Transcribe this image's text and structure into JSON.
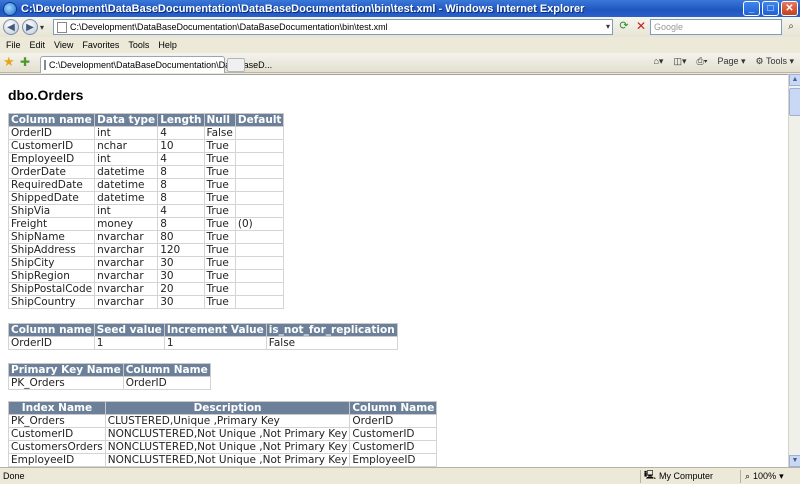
{
  "window": {
    "title": "C:\\Development\\DataBaseDocumentation\\DataBaseDocumentation\\bin\\test.xml - Windows Internet Explorer",
    "buttons": {
      "minimize": "_",
      "maximize": "□",
      "close": "✕"
    }
  },
  "address_bar": {
    "url": "C:\\Development\\DataBaseDocumentation\\DataBaseDocumentation\\bin\\test.xml",
    "search_placeholder": "Google"
  },
  "menu": [
    "File",
    "Edit",
    "View",
    "Favorites",
    "Tools",
    "Help"
  ],
  "tab": {
    "label": "C:\\Development\\DataBaseDocumentation\\DataBaseD..."
  },
  "toolbar": {
    "page_label": "Page",
    "tools_label": "Tools"
  },
  "document": {
    "title": "dbo.Orders",
    "columns_table": {
      "headers": [
        "Column name",
        "Data type",
        "Length",
        "Null",
        "Default"
      ],
      "rows": [
        [
          "OrderID",
          "int",
          "4",
          "False",
          ""
        ],
        [
          "CustomerID",
          "nchar",
          "10",
          "True",
          ""
        ],
        [
          "EmployeeID",
          "int",
          "4",
          "True",
          ""
        ],
        [
          "OrderDate",
          "datetime",
          "8",
          "True",
          ""
        ],
        [
          "RequiredDate",
          "datetime",
          "8",
          "True",
          ""
        ],
        [
          "ShippedDate",
          "datetime",
          "8",
          "True",
          ""
        ],
        [
          "ShipVia",
          "int",
          "4",
          "True",
          ""
        ],
        [
          "Freight",
          "money",
          "8",
          "True",
          "(0)"
        ],
        [
          "ShipName",
          "nvarchar",
          "80",
          "True",
          ""
        ],
        [
          "ShipAddress",
          "nvarchar",
          "120",
          "True",
          ""
        ],
        [
          "ShipCity",
          "nvarchar",
          "30",
          "True",
          ""
        ],
        [
          "ShipRegion",
          "nvarchar",
          "30",
          "True",
          ""
        ],
        [
          "ShipPostalCode",
          "nvarchar",
          "20",
          "True",
          ""
        ],
        [
          "ShipCountry",
          "nvarchar",
          "30",
          "True",
          ""
        ]
      ]
    },
    "identity_table": {
      "headers": [
        "Column name",
        "Seed value",
        "Increment Value",
        "is_not_for_replication"
      ],
      "rows": [
        [
          "OrderID",
          "1",
          "1",
          "False"
        ]
      ]
    },
    "pk_table": {
      "headers": [
        "Primary Key Name",
        "Column Name"
      ],
      "rows": [
        [
          "PK_Orders",
          "OrderID"
        ]
      ]
    },
    "index_table": {
      "headers": [
        "Index Name",
        "Description",
        "Column Name"
      ],
      "rows": [
        [
          "PK_Orders",
          "CLUSTERED,Unique ,Primary Key",
          "OrderID"
        ],
        [
          "CustomerID",
          "NONCLUSTERED,Not Unique ,Not Primary Key",
          "CustomerID"
        ],
        [
          "CustomersOrders",
          "NONCLUSTERED,Not Unique ,Not Primary Key",
          "CustomerID"
        ],
        [
          "EmployeeID",
          "NONCLUSTERED,Not Unique ,Not Primary Key",
          "EmployeeID"
        ]
      ]
    }
  },
  "status_bar": {
    "status": "Done",
    "zone": "My Computer",
    "zoom": "100%"
  }
}
